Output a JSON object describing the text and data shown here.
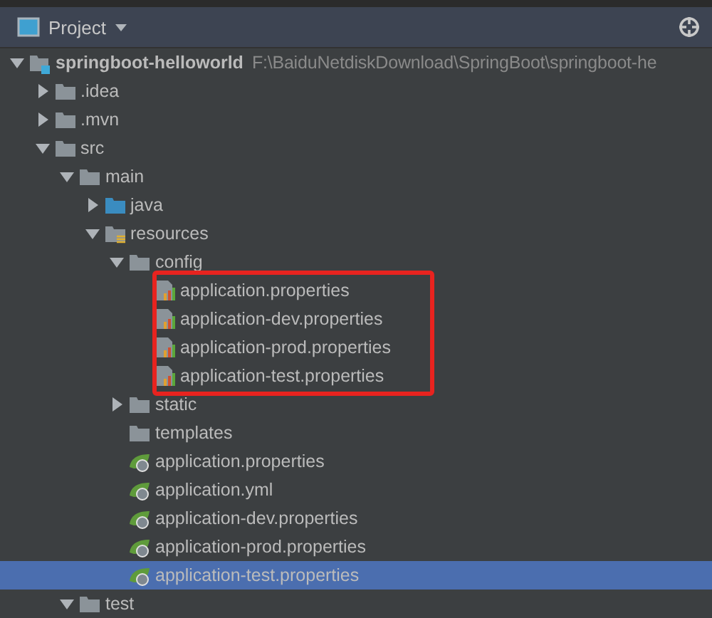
{
  "panel": {
    "title": "Project"
  },
  "tree": [
    {
      "kind": "module",
      "label": "springboot-helloworld",
      "path": "F:\\BaiduNetdiskDownload\\SpringBoot\\springboot-he",
      "expanded": true,
      "selected": false,
      "children": [
        {
          "kind": "folder",
          "label": ".idea",
          "expanded": false,
          "selected": false
        },
        {
          "kind": "folder",
          "label": ".mvn",
          "expanded": false,
          "selected": false
        },
        {
          "kind": "folder",
          "label": "src",
          "expanded": true,
          "selected": false,
          "children": [
            {
              "kind": "folder",
              "label": "main",
              "expanded": true,
              "selected": false,
              "children": [
                {
                  "kind": "source-folder",
                  "label": "java",
                  "expanded": false,
                  "selected": false
                },
                {
                  "kind": "resources-folder",
                  "label": "resources",
                  "expanded": true,
                  "selected": false,
                  "children": [
                    {
                      "kind": "folder",
                      "label": "config",
                      "expanded": true,
                      "selected": false,
                      "highlight_box": true,
                      "children": [
                        {
                          "kind": "properties",
                          "label": "application.properties",
                          "selected": false
                        },
                        {
                          "kind": "properties",
                          "label": "application-dev.properties",
                          "selected": false
                        },
                        {
                          "kind": "properties",
                          "label": "application-prod.properties",
                          "selected": false
                        },
                        {
                          "kind": "properties",
                          "label": "application-test.properties",
                          "selected": false
                        }
                      ]
                    },
                    {
                      "kind": "folder",
                      "label": "static",
                      "expanded": false,
                      "selected": false
                    },
                    {
                      "kind": "folder",
                      "label": "templates",
                      "selected": false
                    },
                    {
                      "kind": "spring",
                      "label": "application.properties",
                      "selected": false
                    },
                    {
                      "kind": "spring",
                      "label": "application.yml",
                      "selected": false
                    },
                    {
                      "kind": "spring",
                      "label": "application-dev.properties",
                      "selected": false
                    },
                    {
                      "kind": "spring",
                      "label": "application-prod.properties",
                      "selected": false
                    },
                    {
                      "kind": "spring",
                      "label": "application-test.properties",
                      "selected": true
                    }
                  ]
                }
              ]
            },
            {
              "kind": "folder",
              "label": "test",
              "expanded": true,
              "selected": false
            }
          ]
        }
      ]
    }
  ]
}
